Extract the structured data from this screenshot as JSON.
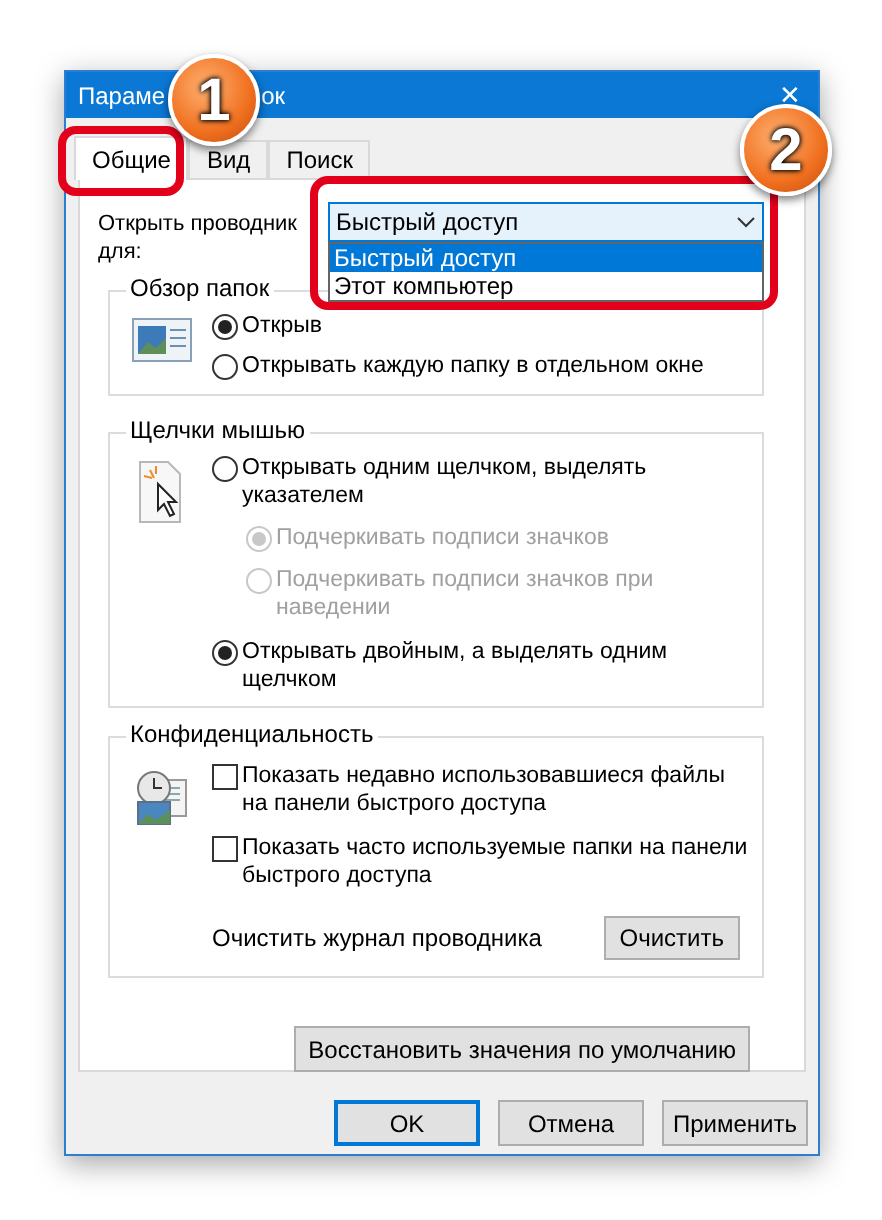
{
  "window": {
    "title_parts": [
      "Параме",
      "ок"
    ],
    "close": "✕"
  },
  "tabs": [
    {
      "label": "Общие",
      "selected": true
    },
    {
      "label": "Вид",
      "selected": false
    },
    {
      "label": "Поиск",
      "selected": false
    }
  ],
  "open_explorer": {
    "label": "Открыть проводник",
    "label_2": "для:",
    "value": "Быстрый доступ",
    "expanded": true,
    "options": [
      {
        "label": "Быстрый доступ",
        "selected": true
      },
      {
        "label": "Этот компьютер",
        "selected": false
      }
    ]
  },
  "groups": [
    {
      "title": "Обзор папок",
      "items": [
        {
          "kind": "radio",
          "label": "Открыв",
          "checked": true,
          "disabled": false
        },
        {
          "kind": "radio",
          "label": "Открывать каждую папку в отдельном окне",
          "checked": false,
          "disabled": false
        }
      ]
    },
    {
      "title": "Щелчки мышью",
      "items": [
        {
          "kind": "radio",
          "label": "Открывать одним щелчком, выделять указателем",
          "checked": false,
          "disabled": false,
          "children": [
            {
              "kind": "radio",
              "label": "Подчеркивать подписи значков",
              "checked": true,
              "disabled": true
            },
            {
              "kind": "radio",
              "label": "Подчеркивать подписи значков при наведении",
              "checked": false,
              "disabled": true
            }
          ]
        },
        {
          "kind": "radio",
          "label": "Открывать двойным, а выделять одним щелчком",
          "checked": true,
          "disabled": false
        }
      ]
    },
    {
      "title": "Конфиденциальность",
      "items": [
        {
          "kind": "checkbox",
          "label": "Показать недавно использовавшиеся файлы на панели быстрого доступа",
          "checked": false
        },
        {
          "kind": "checkbox",
          "label": "Показать часто используемые папки на панели быстрого доступа",
          "checked": false
        },
        {
          "kind": "action",
          "label": "Очистить журнал проводника",
          "button": "Очистить"
        }
      ]
    }
  ],
  "restore_button": "Восстановить значения по умолчанию",
  "buttons": [
    {
      "label": "OK",
      "default": true
    },
    {
      "label": "Отмена",
      "default": false
    },
    {
      "label": "Применить",
      "default": false
    }
  ],
  "annotations": [
    {
      "number": "1"
    },
    {
      "number": "2"
    }
  ]
}
